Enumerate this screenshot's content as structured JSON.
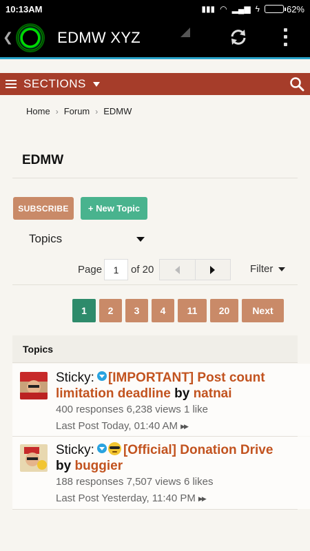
{
  "status_bar": {
    "time": "10:13AM",
    "battery": "62%",
    "battery_level": 0.62
  },
  "app_bar": {
    "title": "EDMW XYZ",
    "refresh_icon": "refresh-icon",
    "menu_icon": "overflow-menu-icon"
  },
  "sections_bar": {
    "label": "SECTIONS",
    "icon": "hamburger-icon",
    "search_icon": "search-icon"
  },
  "breadcrumb": [
    "Home",
    "Forum",
    "EDMW"
  ],
  "page_title": "EDMW",
  "actions": {
    "subscribe": "SUBSCRIBE",
    "new_topic": "+ New Topic"
  },
  "topics_select": {
    "value": "Topics"
  },
  "pager": {
    "page_label": "Page",
    "current_page": "1",
    "of_label": "of 20",
    "filter_label": "Filter"
  },
  "page_buttons": [
    "1",
    "2",
    "3",
    "4",
    "11",
    "20",
    "Next"
  ],
  "topics_header": "Topics",
  "colors": {
    "brand_red": "#a63d2a",
    "accent_green": "#49b38e",
    "accent_tan": "#c98a68",
    "link": "#c2531f"
  },
  "topics": [
    {
      "prefix": "Sticky:",
      "title": "[IMPORTANT] Post count limitation deadline",
      "title_line1": "[IMPORTANT] Post count",
      "title_line2": "limitation deadline",
      "by": "by",
      "author": "natnai",
      "stats": "400 responses 6,238 views 1 like",
      "last_post": "Last Post Today, 01:40 AM"
    },
    {
      "prefix": "Sticky:",
      "title": "[Official] Donation Drive",
      "by": "by",
      "author": "buggier",
      "stats": "188 responses 7,507 views 6 likes",
      "last_post": "Last Post Yesterday, 11:40 PM"
    }
  ]
}
